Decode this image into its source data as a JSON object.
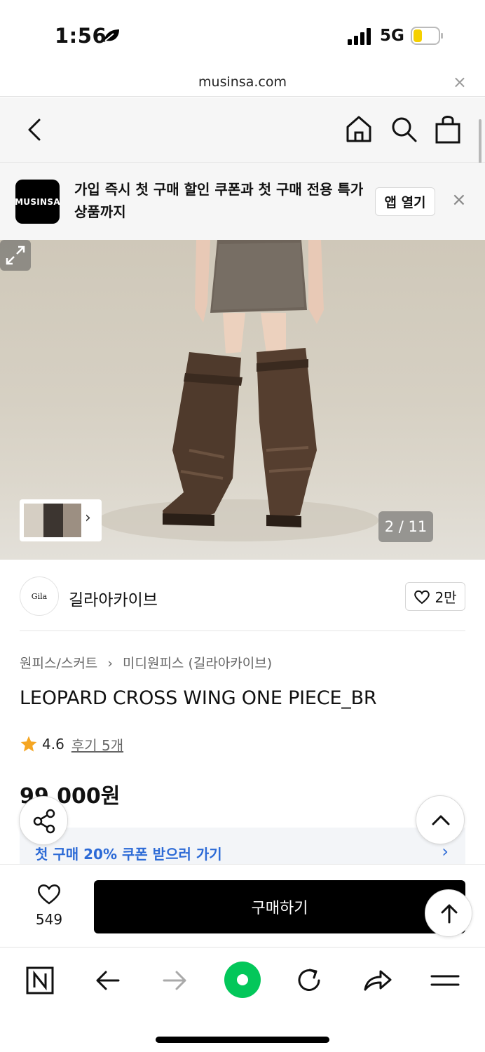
{
  "status_bar": {
    "time": "1:56",
    "network": "5G",
    "battery_color": "#f5d000"
  },
  "browser": {
    "url": "musinsa.com",
    "close_glyph": "×"
  },
  "nav": {
    "icons": [
      "back-icon",
      "home-icon",
      "search-icon",
      "bag-icon"
    ]
  },
  "promo": {
    "logo_text": "MUSINSA",
    "text": "가입 즉시 첫 구매 할인 쿠폰과 첫 구매 전용 특가 상품까지",
    "open_app_label": "앱 열기",
    "close_glyph": "×"
  },
  "gallery": {
    "counter": "2 / 11",
    "thumb_chevron": "›"
  },
  "brand": {
    "logo_text": "Gila",
    "name": "길라아카이브",
    "like_count": "2만"
  },
  "product": {
    "category": "원피스/스커트",
    "subcategory": "미디원피스 (길라아카이브)",
    "breadcrumb_separator": "›",
    "title": "LEOPARD CROSS WING ONE PIECE_BR",
    "rating": "4.6",
    "reviews": "후기 5개",
    "price": "99,000원"
  },
  "coupon": {
    "text": "첫 구매 20% 쿠폰 받으러 가기",
    "chevron": "›"
  },
  "buy_bar": {
    "wish_count": "549",
    "buy_label": "구매하기"
  },
  "colors": {
    "accent_blue": "#2c6ad6",
    "star": "#f5a623",
    "buy_button": "#000000",
    "naver_green": "#03c75a"
  }
}
